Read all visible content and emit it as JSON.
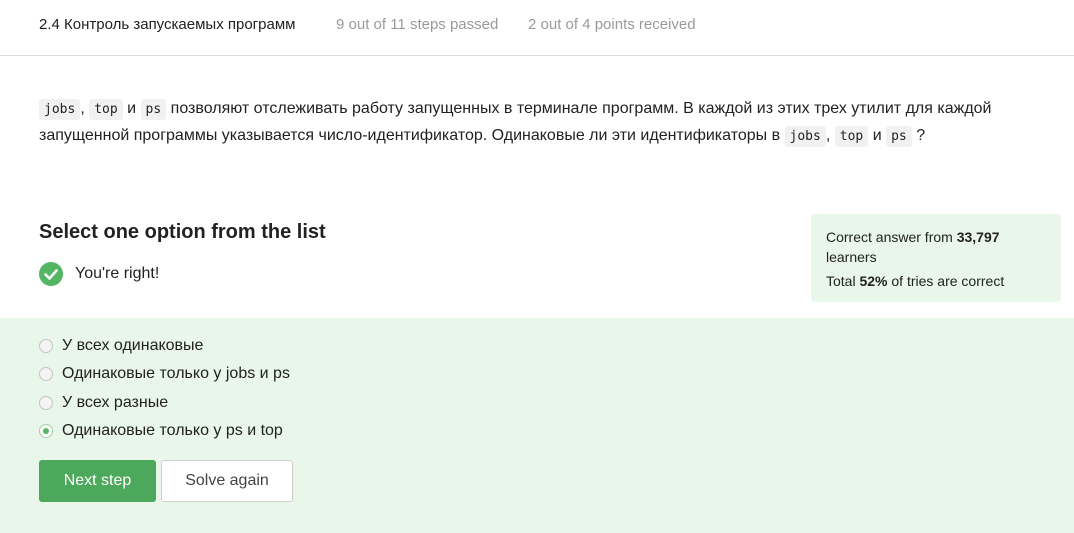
{
  "header": {
    "lesson_title": "2.4 Контроль запускаемых программ",
    "steps_progress": "9 out of 11 steps passed",
    "points_progress": "2 out of 4 points  received"
  },
  "question": {
    "code_jobs": "jobs",
    "code_top": "top",
    "code_ps": "ps",
    "sep_comma": ",",
    "word_and": "и",
    "text_part1": "позволяют отслеживать работу запущенных в терминале программ. В каждой из этих трех утилит для каждой запущенной программы указывается число-идентификатор. Одинаковые ли эти идентификаторы в",
    "text_end": "?"
  },
  "quiz": {
    "heading": "Select one option from the list",
    "status": "You're right!",
    "options": [
      {
        "label": "У всех одинаковые",
        "selected": false
      },
      {
        "label": "Одинаковые только у jobs и ps",
        "selected": false
      },
      {
        "label": "У всех разные",
        "selected": false
      },
      {
        "label": "Одинаковые только у ps и top",
        "selected": true
      }
    ],
    "next_label": "Next step",
    "solve_again_label": "Solve again"
  },
  "stats": {
    "prefix": "Correct answer from",
    "learners_count": "33,797",
    "learners_word": "learners",
    "total_prefix": "Total",
    "percent": "52%",
    "total_suffix": "of tries are correct"
  },
  "colors": {
    "accent_green": "#4ca85a",
    "success_bg": "#e9f6ea",
    "muted_text": "#9a9a9a"
  },
  "icons": {
    "status_icon": "check-circle-icon"
  }
}
